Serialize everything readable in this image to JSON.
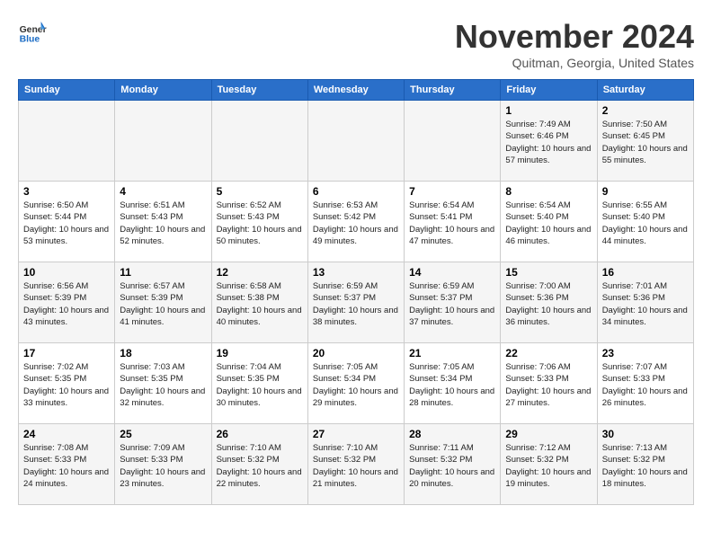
{
  "header": {
    "logo": {
      "general": "General",
      "blue": "Blue"
    },
    "title": "November 2024",
    "location": "Quitman, Georgia, United States"
  },
  "days_of_week": [
    "Sunday",
    "Monday",
    "Tuesday",
    "Wednesday",
    "Thursday",
    "Friday",
    "Saturday"
  ],
  "weeks": [
    [
      {
        "day": "",
        "info": ""
      },
      {
        "day": "",
        "info": ""
      },
      {
        "day": "",
        "info": ""
      },
      {
        "day": "",
        "info": ""
      },
      {
        "day": "",
        "info": ""
      },
      {
        "day": "1",
        "info": "Sunrise: 7:49 AM\nSunset: 6:46 PM\nDaylight: 10 hours and 57 minutes."
      },
      {
        "day": "2",
        "info": "Sunrise: 7:50 AM\nSunset: 6:45 PM\nDaylight: 10 hours and 55 minutes."
      }
    ],
    [
      {
        "day": "3",
        "info": "Sunrise: 6:50 AM\nSunset: 5:44 PM\nDaylight: 10 hours and 53 minutes."
      },
      {
        "day": "4",
        "info": "Sunrise: 6:51 AM\nSunset: 5:43 PM\nDaylight: 10 hours and 52 minutes."
      },
      {
        "day": "5",
        "info": "Sunrise: 6:52 AM\nSunset: 5:43 PM\nDaylight: 10 hours and 50 minutes."
      },
      {
        "day": "6",
        "info": "Sunrise: 6:53 AM\nSunset: 5:42 PM\nDaylight: 10 hours and 49 minutes."
      },
      {
        "day": "7",
        "info": "Sunrise: 6:54 AM\nSunset: 5:41 PM\nDaylight: 10 hours and 47 minutes."
      },
      {
        "day": "8",
        "info": "Sunrise: 6:54 AM\nSunset: 5:40 PM\nDaylight: 10 hours and 46 minutes."
      },
      {
        "day": "9",
        "info": "Sunrise: 6:55 AM\nSunset: 5:40 PM\nDaylight: 10 hours and 44 minutes."
      }
    ],
    [
      {
        "day": "10",
        "info": "Sunrise: 6:56 AM\nSunset: 5:39 PM\nDaylight: 10 hours and 43 minutes."
      },
      {
        "day": "11",
        "info": "Sunrise: 6:57 AM\nSunset: 5:39 PM\nDaylight: 10 hours and 41 minutes."
      },
      {
        "day": "12",
        "info": "Sunrise: 6:58 AM\nSunset: 5:38 PM\nDaylight: 10 hours and 40 minutes."
      },
      {
        "day": "13",
        "info": "Sunrise: 6:59 AM\nSunset: 5:37 PM\nDaylight: 10 hours and 38 minutes."
      },
      {
        "day": "14",
        "info": "Sunrise: 6:59 AM\nSunset: 5:37 PM\nDaylight: 10 hours and 37 minutes."
      },
      {
        "day": "15",
        "info": "Sunrise: 7:00 AM\nSunset: 5:36 PM\nDaylight: 10 hours and 36 minutes."
      },
      {
        "day": "16",
        "info": "Sunrise: 7:01 AM\nSunset: 5:36 PM\nDaylight: 10 hours and 34 minutes."
      }
    ],
    [
      {
        "day": "17",
        "info": "Sunrise: 7:02 AM\nSunset: 5:35 PM\nDaylight: 10 hours and 33 minutes."
      },
      {
        "day": "18",
        "info": "Sunrise: 7:03 AM\nSunset: 5:35 PM\nDaylight: 10 hours and 32 minutes."
      },
      {
        "day": "19",
        "info": "Sunrise: 7:04 AM\nSunset: 5:35 PM\nDaylight: 10 hours and 30 minutes."
      },
      {
        "day": "20",
        "info": "Sunrise: 7:05 AM\nSunset: 5:34 PM\nDaylight: 10 hours and 29 minutes."
      },
      {
        "day": "21",
        "info": "Sunrise: 7:05 AM\nSunset: 5:34 PM\nDaylight: 10 hours and 28 minutes."
      },
      {
        "day": "22",
        "info": "Sunrise: 7:06 AM\nSunset: 5:33 PM\nDaylight: 10 hours and 27 minutes."
      },
      {
        "day": "23",
        "info": "Sunrise: 7:07 AM\nSunset: 5:33 PM\nDaylight: 10 hours and 26 minutes."
      }
    ],
    [
      {
        "day": "24",
        "info": "Sunrise: 7:08 AM\nSunset: 5:33 PM\nDaylight: 10 hours and 24 minutes."
      },
      {
        "day": "25",
        "info": "Sunrise: 7:09 AM\nSunset: 5:33 PM\nDaylight: 10 hours and 23 minutes."
      },
      {
        "day": "26",
        "info": "Sunrise: 7:10 AM\nSunset: 5:32 PM\nDaylight: 10 hours and 22 minutes."
      },
      {
        "day": "27",
        "info": "Sunrise: 7:10 AM\nSunset: 5:32 PM\nDaylight: 10 hours and 21 minutes."
      },
      {
        "day": "28",
        "info": "Sunrise: 7:11 AM\nSunset: 5:32 PM\nDaylight: 10 hours and 20 minutes."
      },
      {
        "day": "29",
        "info": "Sunrise: 7:12 AM\nSunset: 5:32 PM\nDaylight: 10 hours and 19 minutes."
      },
      {
        "day": "30",
        "info": "Sunrise: 7:13 AM\nSunset: 5:32 PM\nDaylight: 10 hours and 18 minutes."
      }
    ]
  ]
}
